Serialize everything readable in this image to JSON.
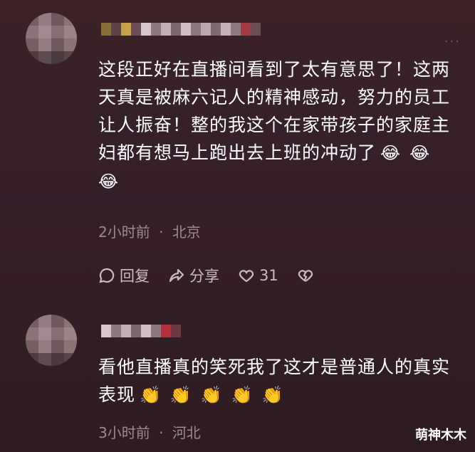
{
  "comments": [
    {
      "text_lines": [
        "这段正好在直播间看到了太有意思了！这两",
        "天真是被麻六记人的精神感动，努力的员工",
        "让人振奋！整的我这个在家带孩子的家庭主",
        "妇都有想马上跑出去上班的冲动了"
      ],
      "emojis_line4": [
        "😂",
        "😂"
      ],
      "emoji_line5": "😂",
      "time": "2小时前",
      "separator": "·",
      "location": "北京",
      "reply_label": "回复",
      "share_label": "分享",
      "like_count": "31"
    },
    {
      "text_lines": [
        "看他直播真的笑死我了这才是普通人的真实",
        "表现"
      ],
      "emojis": [
        "👏",
        "👏",
        "👏",
        "👏",
        "👏"
      ],
      "time": "3小时前",
      "separator": "·",
      "location": "河北"
    }
  ],
  "watermark": "萌神木木",
  "colors": {
    "background": "#35202a",
    "text": "#ffffff",
    "meta": "#9b8b90",
    "action": "#c7bcc0"
  }
}
